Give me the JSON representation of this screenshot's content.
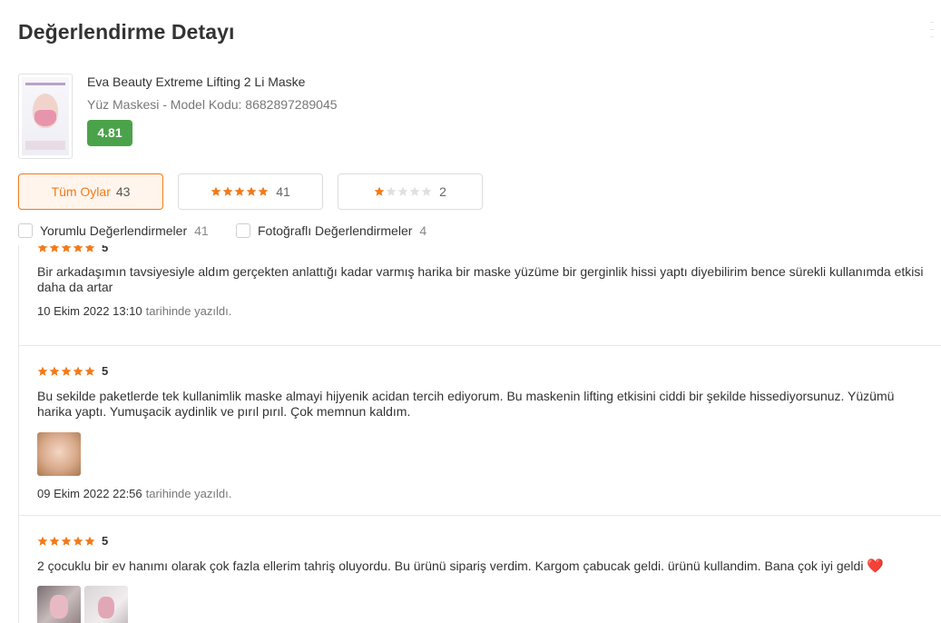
{
  "page": {
    "title": "Değerlendirme Detayı"
  },
  "product": {
    "name": "Eva Beauty Extreme Lifting 2 Li Maske",
    "subtitle": "Yüz Maskesi - Model Kodu: 8682897289045",
    "rating": "4.81"
  },
  "filters": [
    {
      "label": "Tüm Oylar",
      "count": "43",
      "stars": 0,
      "active": true
    },
    {
      "label": "",
      "count": "41",
      "stars": 5,
      "active": false
    },
    {
      "label": "",
      "count": "2",
      "stars": 1,
      "active": false
    }
  ],
  "checkboxes": [
    {
      "label": "Yorumlu Değerlendirmeler",
      "count": "41"
    },
    {
      "label": "Fotoğraflı Değerlendirmeler",
      "count": "4"
    }
  ],
  "reviews": [
    {
      "rating": "5",
      "text": "Bir arkadaşımın tavsiyesiyle aldım gerçekten anlattığı kadar varmış harika bir maske yüzüme bir gerginlik hissi yaptı diyebilirim bence sürekli kullanımda etkisi daha da artar",
      "date": "10 Ekim 2022 13:10",
      "date_suffix": "tarihinde yazıldı.",
      "photos": 0
    },
    {
      "rating": "5",
      "text": "Bu sekilde paketlerde tek kullanimlik maske almayi hijyenik acidan tercih ediyorum. Bu maskenin lifting etkisini ciddi bir şekilde hissediyorsunuz. Yüzümü harika yaptı. Yumuşacik aydinlik ve pırıl pırıl. Çok memnun kaldım.",
      "date": "09 Ekim 2022 22:56",
      "date_suffix": "tarihinde yazıldı.",
      "photos": 1
    },
    {
      "rating": "5",
      "text": "2 çocuklu bir ev hanımı olarak çok fazla ellerim tahriş oluyordu. Bu ürünü sipariş verdim. Kargom çabucak geldi. ürünü kullandim. Bana çok iyi geldi",
      "heart": "❤️",
      "photos": 2
    }
  ],
  "colors": {
    "accent": "#f27a1a",
    "star": "#f27a1a",
    "star_empty": "#e0e0e0",
    "rating_badge": "#4aa34a"
  }
}
